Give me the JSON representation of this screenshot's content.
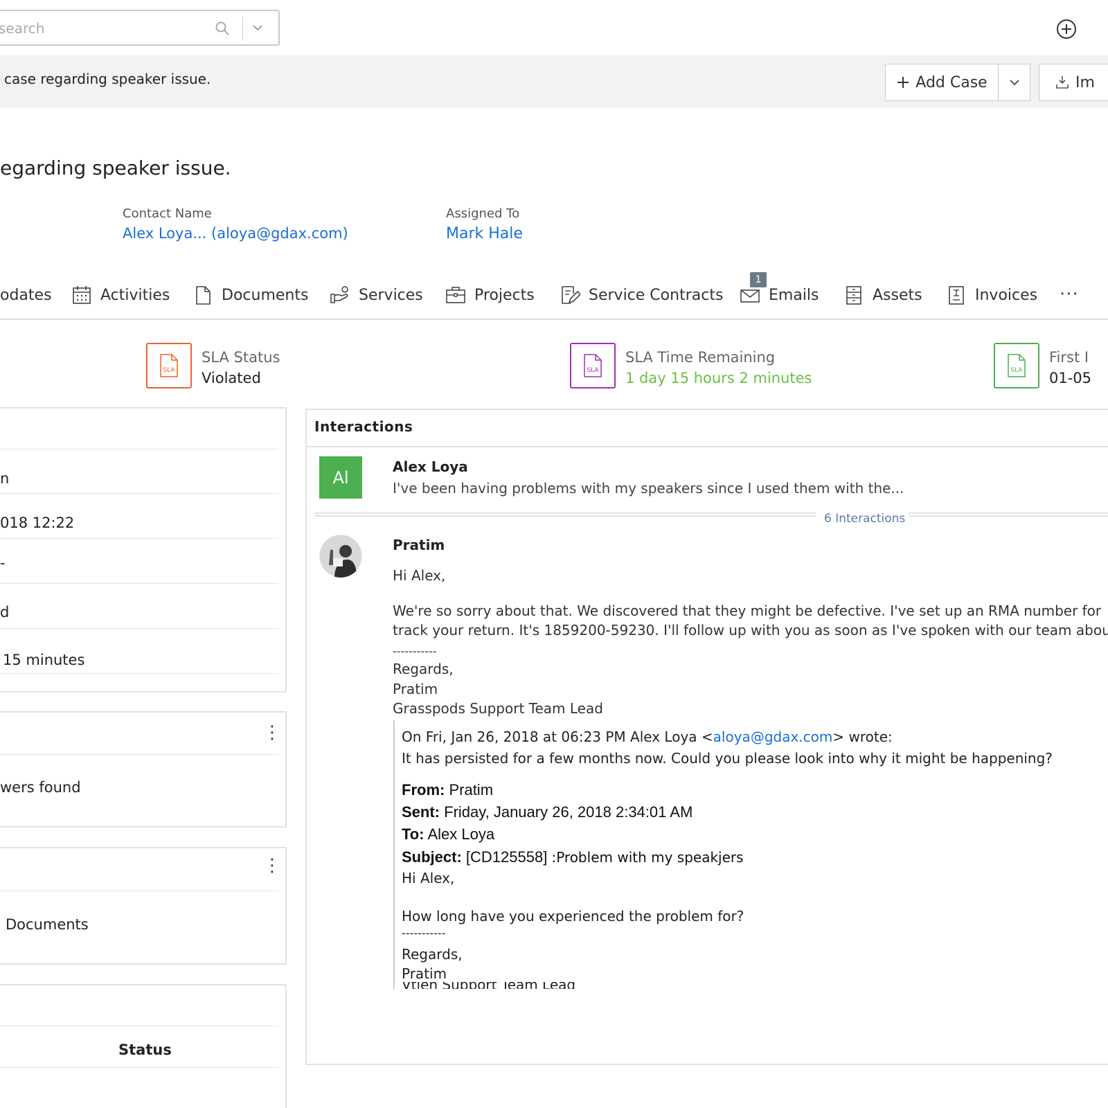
{
  "search": {
    "placeholder": "search"
  },
  "breadcrumb": {
    "text": "case regarding speaker issue."
  },
  "toolbar": {
    "add_case_label": "Add Case",
    "import_label": "Im"
  },
  "case": {
    "subject": "egarding speaker issue.",
    "contact_label": "Contact Name",
    "contact_value": "Alex Loya... (aloya@gdax.com)",
    "assigned_label": "Assigned To",
    "assigned_value": "Mark Hale"
  },
  "tabs": [
    {
      "label": "odates",
      "icon": "updates-icon"
    },
    {
      "label": "Activities",
      "icon": "calendar-icon"
    },
    {
      "label": "Documents",
      "icon": "document-icon"
    },
    {
      "label": "Services",
      "icon": "services-icon"
    },
    {
      "label": "Projects",
      "icon": "briefcase-icon"
    },
    {
      "label": "Service Contracts",
      "icon": "contract-icon"
    },
    {
      "label": "Emails",
      "icon": "envelope-icon",
      "badge": "1"
    },
    {
      "label": "Assets",
      "icon": "assets-icon"
    },
    {
      "label": "Invoices",
      "icon": "invoice-icon"
    }
  ],
  "tabs_more": "···",
  "sla": [
    {
      "title": "SLA Status",
      "value": "Violated",
      "color": "#e8622c",
      "value_color": "#222222"
    },
    {
      "title": "SLA Time Remaining",
      "value": "1 day 15 hours 2 minutes",
      "color": "#a32fb0",
      "value_color": "#6cbf3f"
    },
    {
      "title": "First I",
      "value": "01-05",
      "color": "#4caf50",
      "value_color": "#222222"
    }
  ],
  "sla_icon_text": "SLA",
  "left_card_1": {
    "rows": [
      "n",
      "018 12:22",
      "-",
      "d",
      "15 minutes"
    ]
  },
  "left_card_2": {
    "text": "wers found",
    "menu": "⋮"
  },
  "left_card_3": {
    "text": "Documents",
    "menu": "⋮"
  },
  "left_card_4": {
    "header": "Status"
  },
  "interactions": {
    "title": "Interactions",
    "first": {
      "avatar": "Al",
      "sender": "Alex Loya",
      "snippet": "I've been having problems with my speakers since I used them with the..."
    },
    "count_label": "6 Interactions",
    "reply": {
      "sender": "Pratim",
      "greeting": "Hi Alex,",
      "line1": "We're so sorry about that. We discovered that they might be defective. I've set up an RMA number for",
      "line2": "track your return. It's 1859200-59230. I'll follow up with you as soon as I've spoken with our team abou",
      "sep": "-----------",
      "regards": "Regards,",
      "name": "Pratim",
      "role": "Grasspods Support Team Lead"
    },
    "quoted": {
      "on_prefix": "On Fri, Jan 26, 2018 at 06:23 PM Alex Loya <",
      "email": "aloya@gdax.com",
      "on_suffix": "> wrote:",
      "line": "It has persisted for a few months now. Could you please look into why it might be happening?",
      "from_label": "From:",
      "from_value": "Pratim",
      "sent_label": "Sent:",
      "sent_value": "Friday, January 26, 2018 2:34:01 AM",
      "to_label": "To:",
      "to_value": "Alex Loya",
      "subject_label": "Subject:",
      "subject_value": "[CD125558]",
      "subject_rest": ":Problem with my speakjers",
      "greeting": "Hi Alex,",
      "question": "How long have you experienced the problem for?",
      "sep": "-----------",
      "regards": "Regards,",
      "name": "Pratim",
      "cut": "Vtien Support Team Lead"
    }
  }
}
